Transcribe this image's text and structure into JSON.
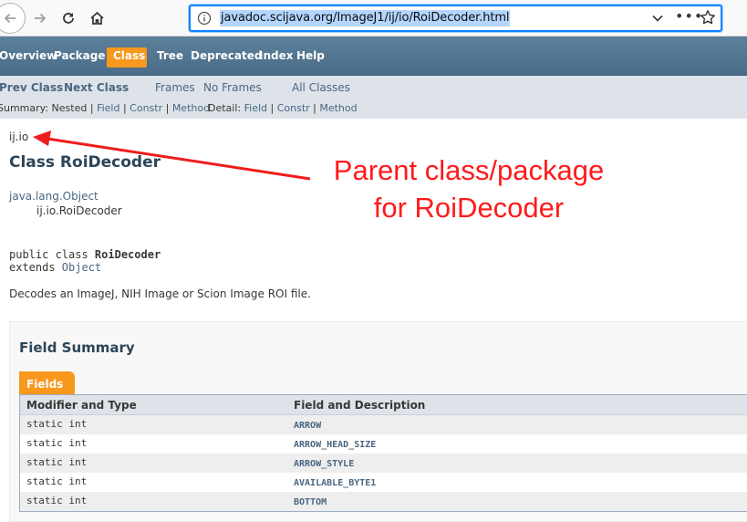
{
  "browser": {
    "url": "javadoc.scijava.org/ImageJ1/ij/io/RoiDecoder.html",
    "more_glyph": "•••"
  },
  "topnav": {
    "items": [
      "Overview",
      "Package",
      "Class",
      "Tree",
      "Deprecated",
      "Index",
      "Help"
    ],
    "active": "Class"
  },
  "subnav": {
    "prev_class": "Prev Class",
    "next_class": "Next Class",
    "frames": "Frames",
    "no_frames": "No Frames",
    "all_classes": "All Classes",
    "summary_prefix": "Summary: Nested | ",
    "summary_field": "Field",
    "summary_constr": "Constr",
    "summary_method": "Method",
    "detail_prefix": "Detail: ",
    "detail_field": "Field",
    "detail_constr": "Constr",
    "detail_method": "Method",
    "sep": " | "
  },
  "page": {
    "package": "ij.io",
    "class_title": "Class RoiDecoder",
    "inheritance_parent": "java.lang.Object",
    "inheritance_child": "ij.io.RoiDecoder",
    "sig_public_class": "public class ",
    "sig_class_name": "RoiDecoder",
    "sig_extends": "extends ",
    "sig_parent": "Object",
    "description": "Decodes an ImageJ, NIH Image or Scion Image ROI file."
  },
  "field_summary": {
    "title": "Field Summary",
    "tab_label": "Fields",
    "col1": "Modifier and Type",
    "col2": "Field and Description",
    "rows": [
      {
        "type": "static int",
        "name": "ARROW"
      },
      {
        "type": "static int",
        "name": "ARROW_HEAD_SIZE"
      },
      {
        "type": "static int",
        "name": "ARROW_STYLE"
      },
      {
        "type": "static int",
        "name": "AVAILABLE_BYTE1"
      },
      {
        "type": "static int",
        "name": "BOTTOM"
      }
    ]
  },
  "annotation": {
    "line1": "Parent class/package",
    "line2": "for RoiDecoder",
    "color": "#ff1a1a"
  }
}
